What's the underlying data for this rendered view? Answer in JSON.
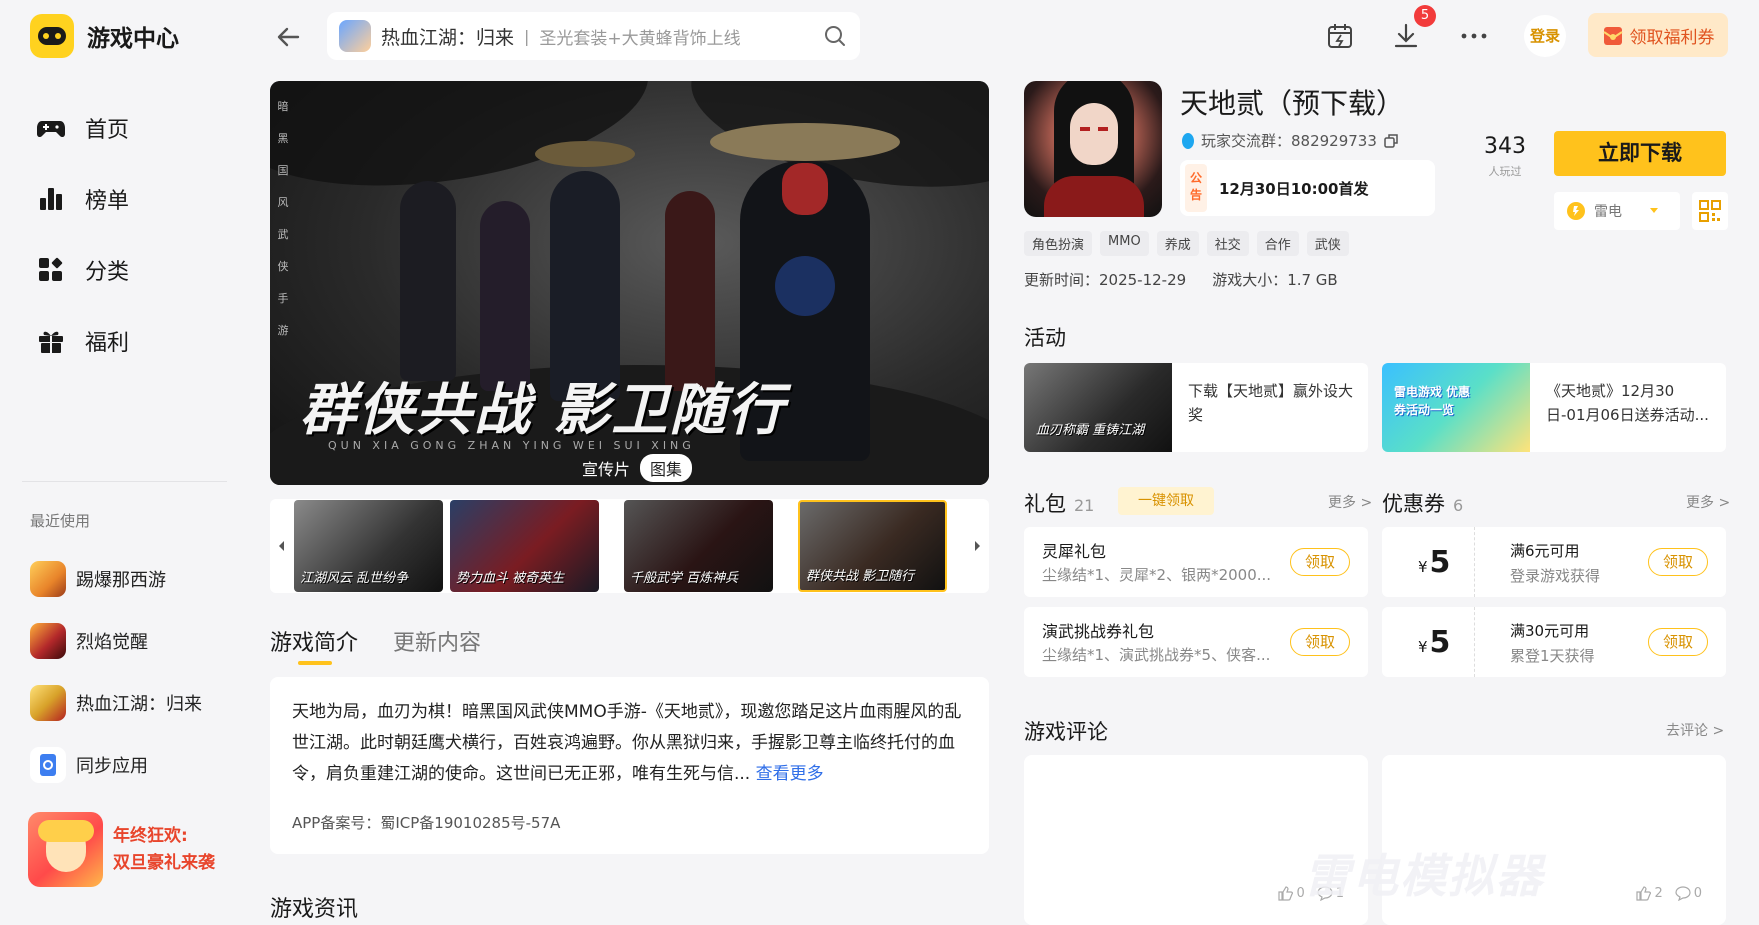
{
  "app": {
    "title": "游戏中心"
  },
  "nav": [
    {
      "label": "首页",
      "icon": "gamepad-icon"
    },
    {
      "label": "榜单",
      "icon": "ranking-icon"
    },
    {
      "label": "分类",
      "icon": "category-icon"
    },
    {
      "label": "福利",
      "icon": "gift-icon"
    }
  ],
  "recent": {
    "title": "最近使用",
    "items": [
      {
        "label": "踢爆那西游",
        "color": "#e8842a"
      },
      {
        "label": "烈焰觉醒",
        "color": "#b3282a"
      },
      {
        "label": "热血江湖：归来",
        "color": "#d8a22a"
      },
      {
        "label": "同步应用",
        "color": "#3d7ef0"
      }
    ]
  },
  "promo": {
    "line1": "年终狂欢:",
    "line2": "双旦豪礼来袭"
  },
  "search": {
    "value": "热血江湖：归来",
    "separator": "|",
    "hint": "圣光套装+大黄蜂背饰上线"
  },
  "topbar": {
    "download_badge": "5",
    "login": "登录",
    "welfare": "领取福利券"
  },
  "banner": {
    "vertical_text": [
      "暗",
      "黑",
      "国",
      "风",
      "武",
      "侠",
      "手",
      "游"
    ],
    "title": "群侠共战 影卫随行",
    "subtitle": "QUN XIA GONG ZHAN  YING WEI SUI XING",
    "tabs": [
      "宣传片",
      "图集"
    ],
    "active_tab": 1
  },
  "thumbnails": [
    {
      "label": "江湖风云 乱世纷争"
    },
    {
      "label": "势力血斗 被奇英生"
    },
    {
      "label": "千般武学 百炼神兵"
    },
    {
      "label": "群侠共战 影卫随行"
    }
  ],
  "desc_tabs": [
    "游戏简介",
    "更新内容"
  ],
  "description": {
    "text": "天地为局，血刃为棋！暗黑国风武侠MMO手游-《天地贰》，现邀您踏足这片血雨腥风的乱世江湖。此时朝廷鹰犬横行，百姓哀鸿遍野。你从黑狱归来，手握影卫尊主临终托付的血令，肩负重建江湖的使命。这世间已无正邪，唯有生死与信...",
    "more": "查看更多",
    "icp": "APP备案号：蜀ICP备19010285号-57A"
  },
  "news_title": "游戏资讯",
  "game": {
    "name": "天地贰（预下载）",
    "qq_group": "玩家交流群：882929733",
    "notice_tag": "公告",
    "notice": "12月30日10:00首发",
    "tags": [
      "角色扮演",
      "MMO",
      "养成",
      "社交",
      "合作",
      "武侠"
    ],
    "update_time": "更新时间：2025-12-29",
    "size": "游戏大小：1.7 GB",
    "players": "343",
    "players_label": "人玩过",
    "download": "立即下载",
    "platform": "雷电"
  },
  "activities": {
    "title": "活动",
    "items": [
      {
        "text": "下载【天地贰】赢外设大奖",
        "image_label": "血刃称霸 重铸江湖"
      },
      {
        "text": "《天地贰》12月30日-01月06日送券活动...",
        "image_label": "雷电游戏 优惠券活动一览"
      }
    ]
  },
  "gifts": {
    "title": "礼包",
    "count": "21",
    "one_click": "一键领取",
    "more": "更多 >",
    "items": [
      {
        "name": "灵犀礼包",
        "desc": "尘缘结*1、灵犀*2、银两*2000...",
        "action": "领取"
      },
      {
        "name": "演武挑战券礼包",
        "desc": "尘缘结*1、演武挑战券*5、侠客...",
        "action": "领取"
      }
    ]
  },
  "coupons": {
    "title": "优惠券",
    "count": "6",
    "more": "更多 >",
    "items": [
      {
        "currency": "¥",
        "amount": "5",
        "name": "满6元可用",
        "desc": "登录游戏获得",
        "action": "领取"
      },
      {
        "currency": "¥",
        "amount": "5",
        "name": "满30元可用",
        "desc": "累登1天获得",
        "action": "领取"
      }
    ]
  },
  "reviews": {
    "title": "游戏评论",
    "go": "去评论 >",
    "items": [
      {
        "likes": "0",
        "comments": "1"
      },
      {
        "likes": "2",
        "comments": "0"
      }
    ]
  },
  "watermark": "雷电模拟器",
  "colors": {
    "accent": "#ffc21c",
    "link": "#2f6ee8",
    "badge": "#f23b3b"
  }
}
